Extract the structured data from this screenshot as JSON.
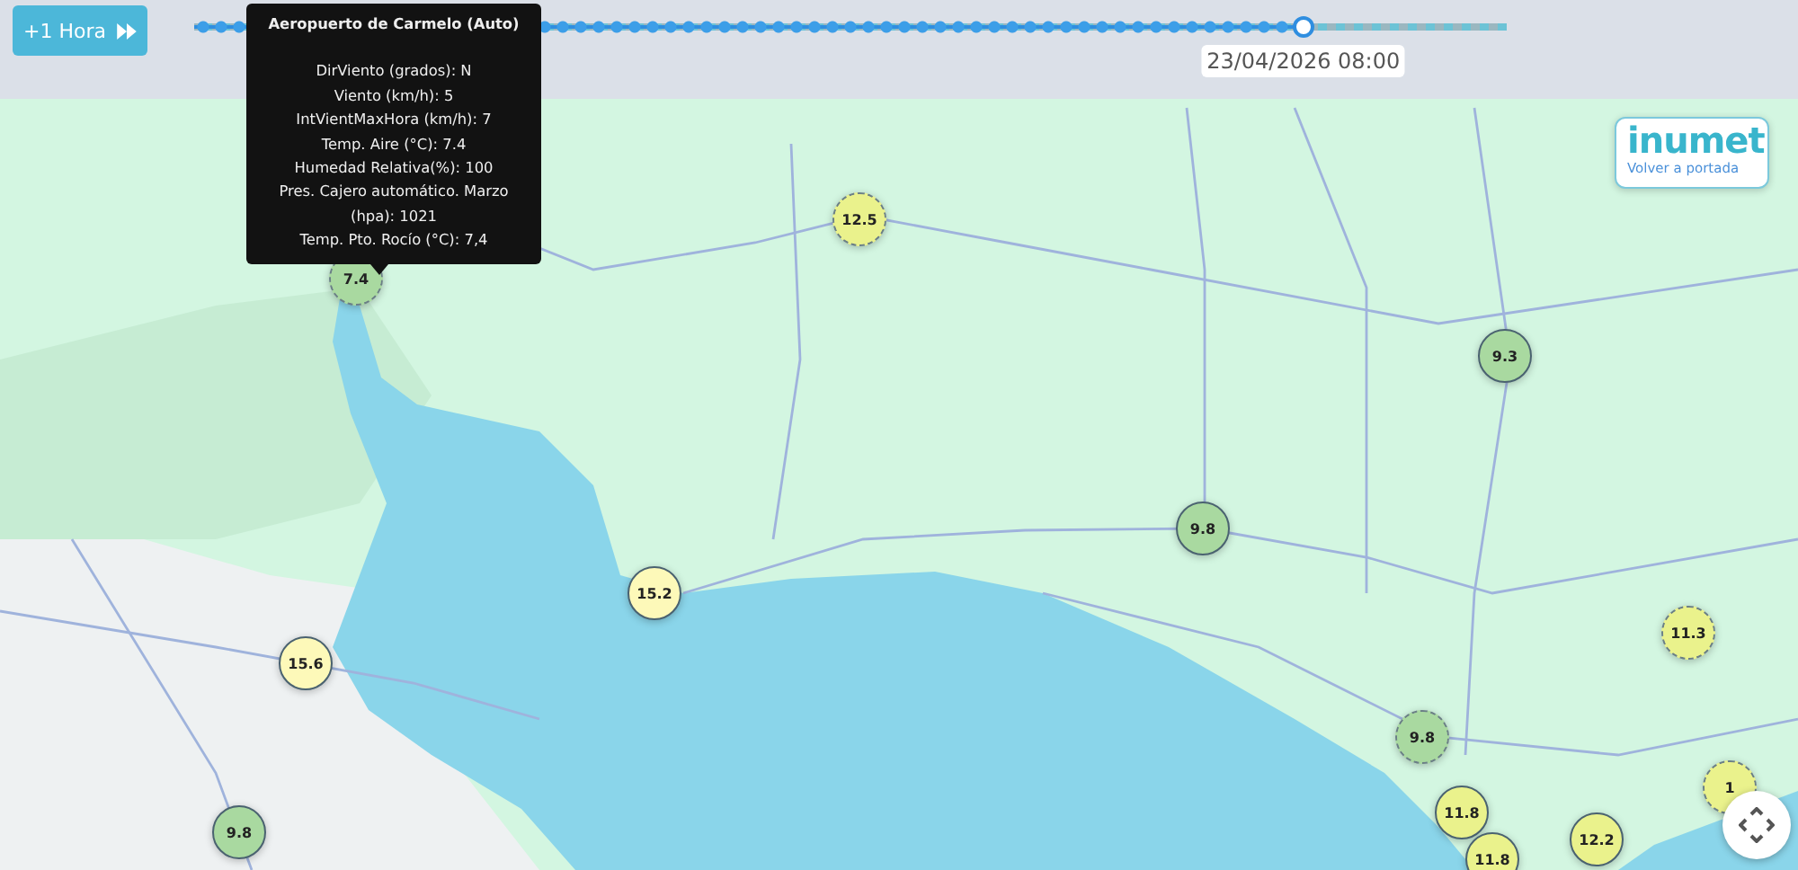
{
  "toolbar": {
    "next_hour_button": {
      "label": "+1 Hora"
    }
  },
  "timeline": {
    "level": 0.845,
    "current_time": "23/04/2026 08:00"
  },
  "tooltip": {
    "title": "Aeropuerto de Carmelo (Auto)",
    "lines": [
      "DirViento (grados): N",
      "Viento (km/h): 5",
      "IntVientMaxHora (km/h): 7",
      "Temp. Aire (°C): 7.4",
      "Humedad Relativa(%): 100",
      "Pres. Cajero automático. Marzo (hpa): 1021",
      "Temp. Pto. Rocío (°C): 7,4"
    ]
  },
  "logo": {
    "name": "inumet",
    "link": "Volver a portada"
  },
  "markers": [
    {
      "value": "7.4",
      "color": "#a9d9a0",
      "dashed": true
    },
    {
      "value": "12.5",
      "color": "#eaf28c",
      "dashed": true
    },
    {
      "value": "9.3",
      "color": "#a9d9a0",
      "dashed": false
    },
    {
      "value": "9.8",
      "color": "#a9d9a0",
      "dashed": false
    },
    {
      "value": "15.2",
      "color": "#fdf9b9",
      "dashed": false
    },
    {
      "value": "15.6",
      "color": "#fdf9b9",
      "dashed": false
    },
    {
      "value": "9.8",
      "color": "#a9d9a0",
      "dashed": false
    },
    {
      "value": "9.8",
      "color": "#a9d9a0",
      "dashed": true
    },
    {
      "value": "11.3",
      "color": "#eaf28c",
      "dashed": true
    },
    {
      "value": "11.8",
      "color": "#eaf28c",
      "dashed": false
    },
    {
      "value": "11.8",
      "color": "#eaf28c",
      "dashed": false
    },
    {
      "value": "12.2",
      "color": "#eaf28c",
      "dashed": false
    },
    {
      "value": "1",
      "color": "#eaf28c",
      "dashed": true
    }
  ]
}
